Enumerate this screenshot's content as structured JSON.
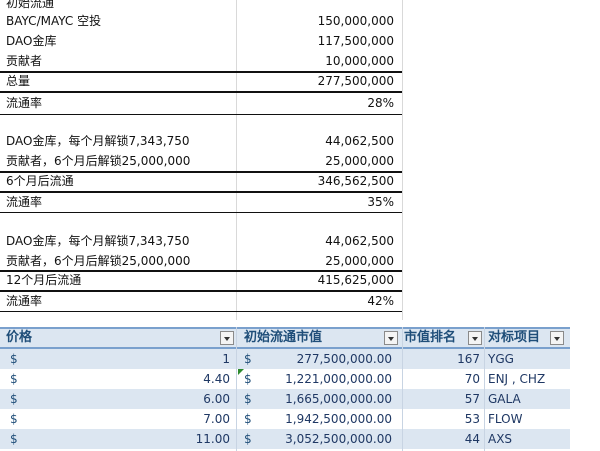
{
  "top_rows": [
    {
      "label": "初始流通",
      "value": ""
    },
    {
      "label": "BAYC/MAYC 空投",
      "value": "150,000,000"
    },
    {
      "label": "DAO金库",
      "value": "117,500,000"
    },
    {
      "label": "贡献者",
      "value": "10,000,000"
    },
    {
      "label": "总量",
      "value": "277,500,000"
    },
    {
      "label": "流通率",
      "value": "28%"
    },
    {
      "label": "",
      "value": ""
    },
    {
      "label": "DAO金库，每个月解锁7,343,750",
      "value": "44,062,500"
    },
    {
      "label": "贡献者，6个月后解锁25,000,000",
      "value": "25,000,000"
    },
    {
      "label": "6个月后流通",
      "value": "346,562,500"
    },
    {
      "label": "流通率",
      "value": "35%"
    },
    {
      "label": "",
      "value": ""
    },
    {
      "label": "DAO金库，每个月解锁7,343,750",
      "value": "44,062,500"
    },
    {
      "label": "贡献者，6个月后解锁25,000,000",
      "value": "25,000,000"
    },
    {
      "label": "12个月后流通",
      "value": "415,625,000"
    },
    {
      "label": "流通率",
      "value": "42%"
    }
  ],
  "table": {
    "headers": [
      "价格",
      "初始流通市值",
      "市值排名",
      "对标项目"
    ],
    "rows": [
      {
        "currency": "$",
        "price": "1",
        "mc_currency": "$",
        "market_cap": "277,500,000.00",
        "rank": "167",
        "project": "YGG"
      },
      {
        "currency": "$",
        "price": "4.40",
        "mc_currency": "$",
        "market_cap": "1,221,000,000.00",
        "rank": "70",
        "project": "ENJ , CHZ"
      },
      {
        "currency": "$",
        "price": "6.00",
        "mc_currency": "$",
        "market_cap": "1,665,000,000.00",
        "rank": "57",
        "project": "GALA"
      },
      {
        "currency": "$",
        "price": "7.00",
        "mc_currency": "$",
        "market_cap": "1,942,500,000.00",
        "rank": "53",
        "project": "FLOW"
      },
      {
        "currency": "$",
        "price": "11.00",
        "mc_currency": "$",
        "market_cap": "3,052,500,000.00",
        "rank": "44",
        "project": "AXS"
      }
    ]
  },
  "colors": {
    "header_bg": "#dce6f1",
    "header_text": "#1f4e79",
    "band": "#dce6f1",
    "error_marker": "#2e8b2e"
  }
}
